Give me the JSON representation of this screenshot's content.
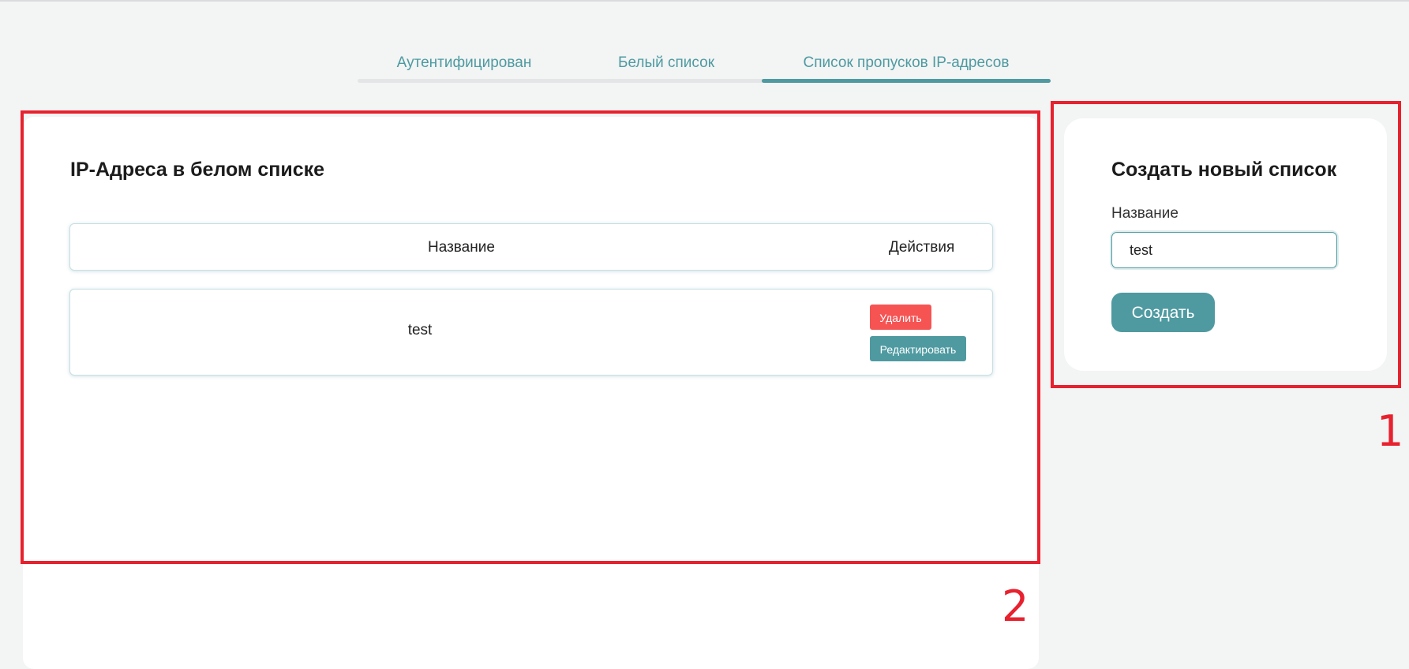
{
  "tabs": [
    {
      "label": "Аутентифицирован",
      "active": false
    },
    {
      "label": "Белый список",
      "active": false
    },
    {
      "label": "Список пропусков IP-адресов",
      "active": true
    }
  ],
  "whitelist": {
    "title": "IP-Адреса в белом списке",
    "columns": {
      "name": "Название",
      "actions": "Действия"
    },
    "rows": [
      {
        "name": "test",
        "delete_label": "Удалить",
        "edit_label": "Редактировать"
      }
    ]
  },
  "create_form": {
    "title": "Создать новый список",
    "name_label": "Название",
    "name_value": "test",
    "submit_label": "Создать"
  },
  "annotations": [
    {
      "label": "1"
    },
    {
      "label": "2"
    }
  ],
  "colors": {
    "accent": "#4f9aa1",
    "danger": "#f65353",
    "annotation": "#e8212e",
    "background": "#f3f4f4"
  }
}
